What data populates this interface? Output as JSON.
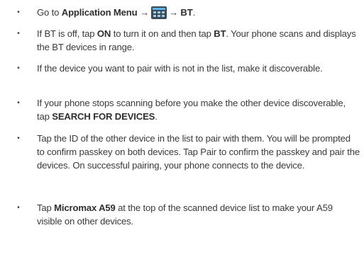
{
  "steps": [
    {
      "go_to": "Go to",
      "app_menu": "Application Menu",
      "arrow1": "→",
      "icon": "app-menu-grid-icon",
      "arrow2": "→",
      "bt": "BT",
      "period": "."
    },
    {
      "s1": "If BT is off, tap ",
      "on": "ON",
      "s2": " to turn it on and then tap ",
      "bt": "BT",
      "s3": ". Your phone scans and displays the BT devices in range."
    },
    {
      "text": "If the device you want to pair with is not in the list, make it discoverable."
    },
    {
      "s1": "If your phone stops scanning before you make the other device discoverable, tap ",
      "search": "SEARCH FOR DEVICES",
      "s2": "."
    },
    {
      "text": "Tap the ID of the other device in the list to pair with them. You will be prompted to confirm passkey on both devices. Tap Pair to confirm the passkey and pair the devices. On successful pairing, your phone connects to the device."
    },
    {
      "s1": "Tap ",
      "device": "Micromax A59",
      "s2": " at the top of the scanned device list to make your A59 visible on other devices."
    }
  ],
  "bullet_char": "•",
  "colors": {
    "text": "#3a3a3a",
    "icon_bg": "#3b4a57",
    "icon_accent": "#5fb3e6"
  }
}
